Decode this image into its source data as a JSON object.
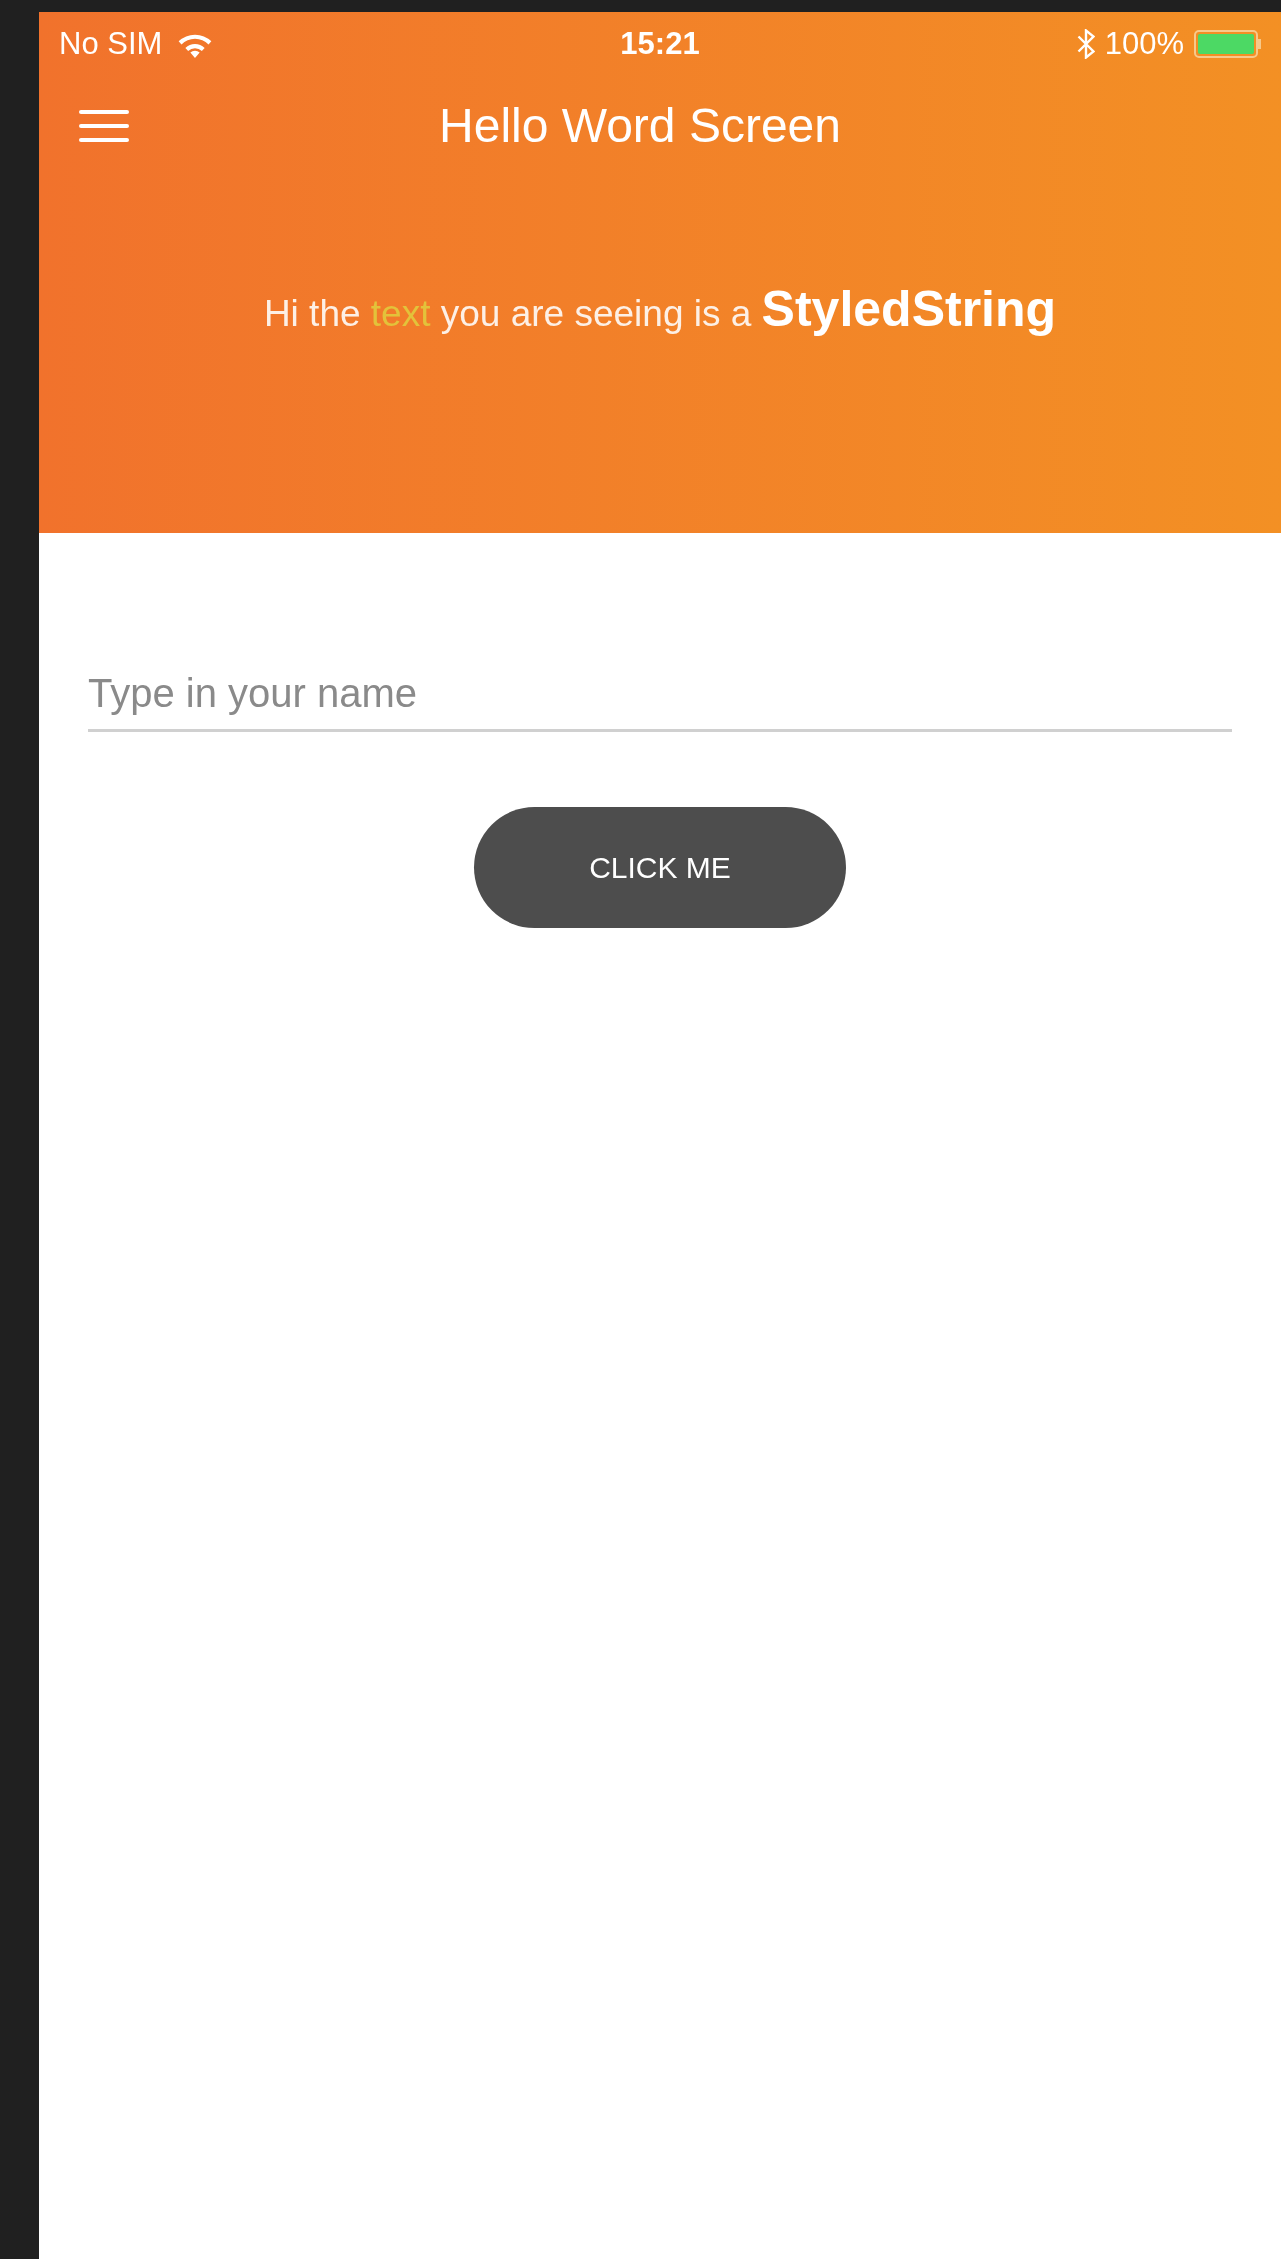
{
  "status_bar": {
    "carrier": "No SIM",
    "time": "15:21",
    "battery": "100%"
  },
  "nav_bar": {
    "title": "Hello Word Screen"
  },
  "banner": {
    "parts": [
      {
        "kind": "plain",
        "text": "Hi the "
      },
      {
        "kind": "highlight",
        "text": "text"
      },
      {
        "kind": "plain",
        "text": " you are seeing is a "
      },
      {
        "kind": "bold",
        "text": "StyledString"
      }
    ]
  },
  "name_field": {
    "placeholder": "Type in your name"
  },
  "button": {
    "label": "CLICK ME"
  }
}
